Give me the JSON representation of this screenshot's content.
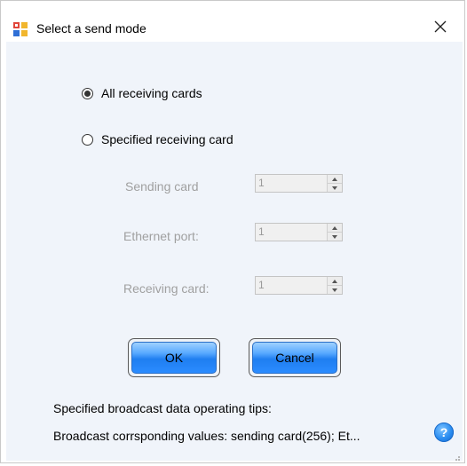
{
  "window": {
    "title": "Select a send mode",
    "icon": "app-window-icon",
    "close_glyph": "✕"
  },
  "send_mode": {
    "options": [
      {
        "label": "All receiving cards",
        "selected": true
      },
      {
        "label": "Specified receiving card",
        "selected": false
      }
    ]
  },
  "fields": [
    {
      "label": "Sending card",
      "value": "1"
    },
    {
      "label": "Ethernet port:",
      "value": "1"
    },
    {
      "label": "Receiving card:",
      "value": "1"
    }
  ],
  "buttons": {
    "ok_label": "OK",
    "cancel_label": "Cancel"
  },
  "tips": {
    "heading": "Specified broadcast data operating tips:",
    "text": "Broadcast corrsponding values: sending card(256); Et...",
    "help_glyph": "?"
  },
  "colors": {
    "client_background": "#f0f4fa",
    "button_blue": "#2b8cff",
    "disabled_text": "#a0a0a0",
    "help_icon": "#2a8cf0"
  }
}
